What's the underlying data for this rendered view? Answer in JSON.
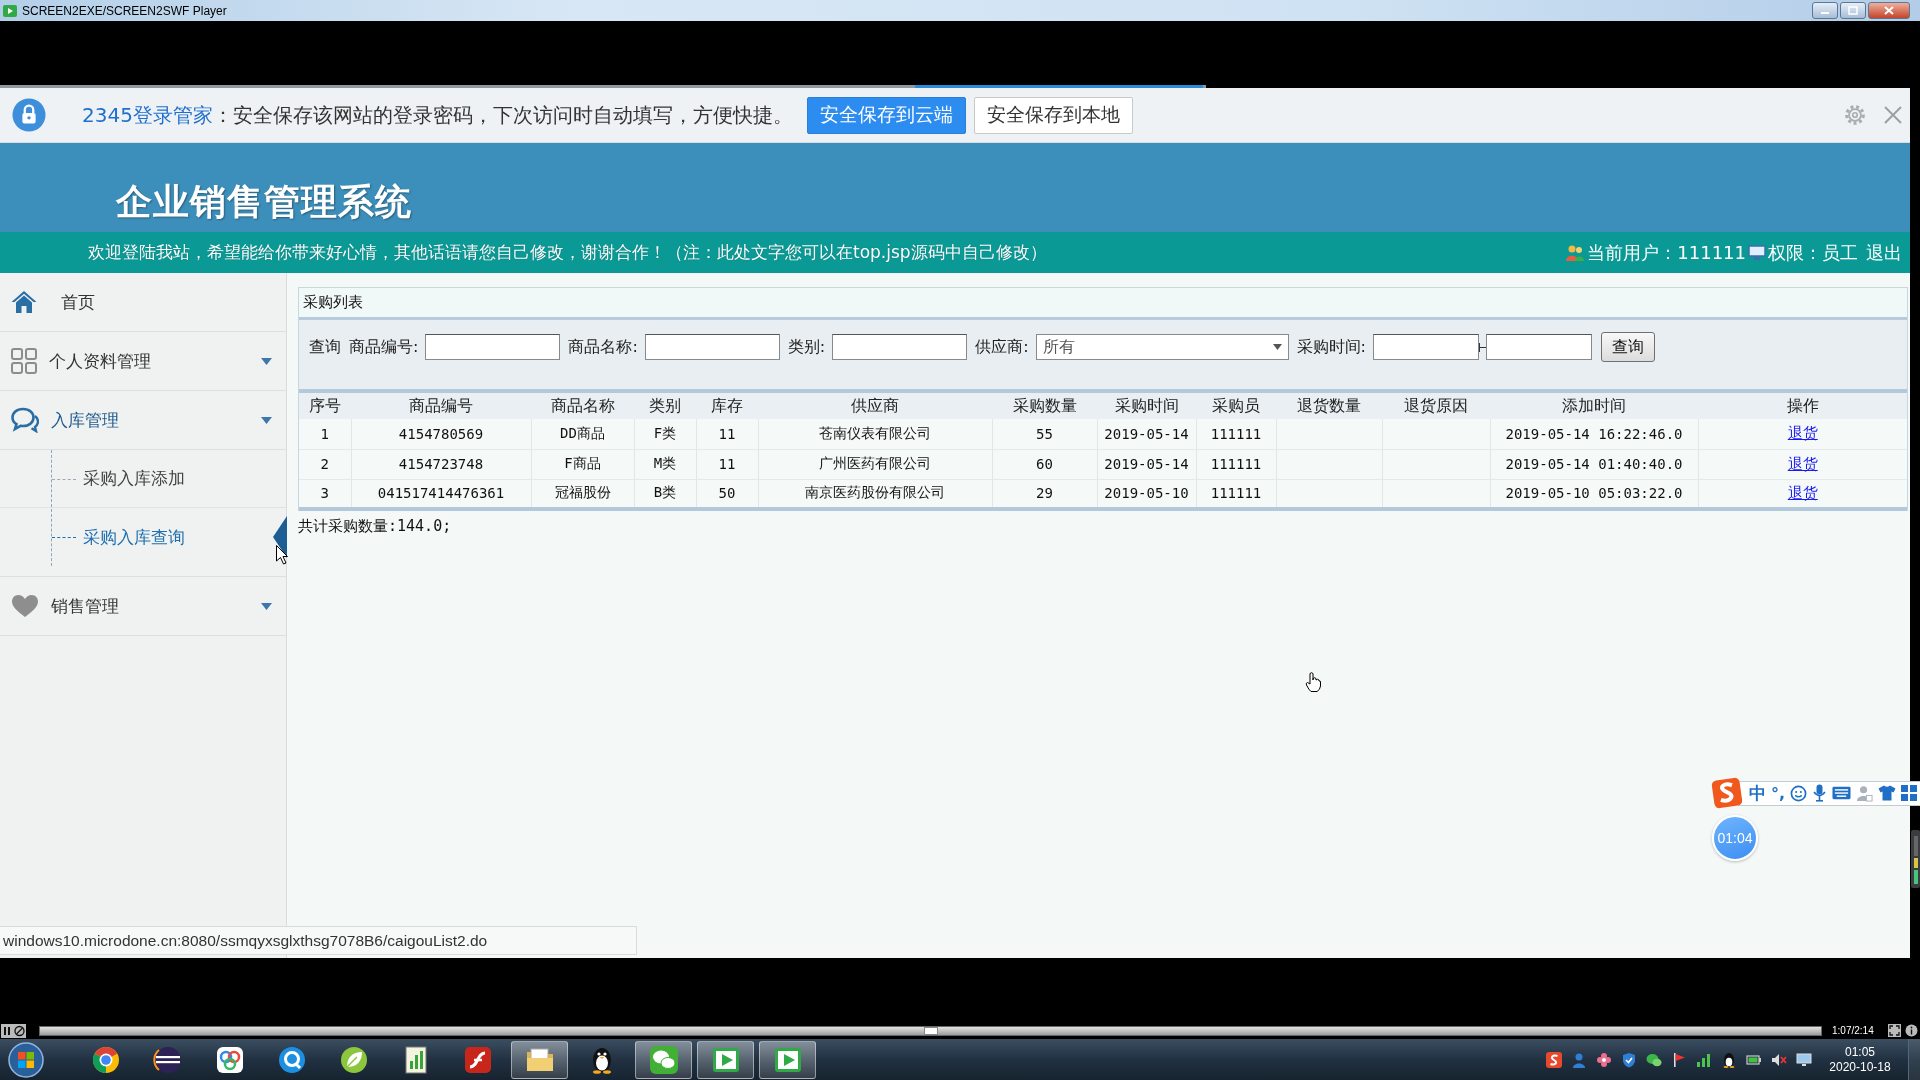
{
  "player_window": {
    "title": "SCREEN2EXE/SCREEN2SWF Player"
  },
  "password_bar": {
    "brand": "2345登录管家",
    "message": "：安全保存该网站的登录密码，下次访问时自动填写，方便快捷。",
    "buttons": [
      {
        "label": "安全保存到云端",
        "kind": "primary"
      },
      {
        "label": "安全保存到本地",
        "kind": "secondary"
      }
    ]
  },
  "header": {
    "title": "企业销售管理系统",
    "welcome": "欢迎登陆我站，希望能给你带来好心情，其他话语请您自己修改，谢谢合作！（注：此处文字您可以在top.jsp源码中自己修改）",
    "user": "当前用户：111111",
    "role": "权限：员工",
    "logout": "退出"
  },
  "sidebar": {
    "items": [
      {
        "kind": "link",
        "label": "首页"
      },
      {
        "kind": "group",
        "label": "个人资料管理",
        "expanded": false
      },
      {
        "kind": "group",
        "label": "入库管理",
        "expanded": true,
        "children": [
          {
            "label": "采购入库添加",
            "selected": false
          },
          {
            "label": "采购入库查询",
            "selected": true
          }
        ]
      },
      {
        "kind": "group",
        "label": "销售管理",
        "expanded": false
      }
    ]
  },
  "panel": {
    "title": "采购列表",
    "search": {
      "label": "查询",
      "fields": [
        {
          "kind": "input",
          "label": "商品编号:"
        },
        {
          "kind": "input",
          "label": "商品名称:"
        },
        {
          "kind": "input",
          "label": "类别:"
        },
        {
          "kind": "select",
          "label": "供应商:",
          "value": "所有"
        },
        {
          "kind": "range",
          "label": "采购时间:"
        }
      ],
      "button": "查询"
    },
    "table": {
      "columns": [
        "序号",
        "商品编号",
        "商品名称",
        "类别",
        "库存",
        "供应商",
        "采购数量",
        "采购时间",
        "采购员",
        "退货数量",
        "退货原因",
        "添加时间",
        "操作"
      ],
      "rows": [
        {
          "no": "1",
          "product_code": "4154780569",
          "product_name": "DD商品",
          "category": "F类",
          "stock": "11",
          "supplier": "苍南仪表有限公司",
          "quantity": "55",
          "purchase_date": "2019-05-14",
          "buyer": "111111",
          "added_time": "2019-05-14 16:22:46.0",
          "action": "退货"
        },
        {
          "no": "2",
          "product_code": "4154723748",
          "product_name": "F商品",
          "category": "M类",
          "stock": "11",
          "supplier": "广州医药有限公司",
          "quantity": "60",
          "purchase_date": "2019-05-14",
          "buyer": "111111",
          "added_time": "2019-05-14 01:40:40.0",
          "action": "退货"
        },
        {
          "no": "3",
          "product_code": "041517414476361",
          "product_name": "冠福股份",
          "category": "B类",
          "stock": "50",
          "supplier": "南京医药股份有限公司",
          "quantity": "29",
          "purchase_date": "2019-05-10",
          "buyer": "111111",
          "added_time": "2019-05-10 05:03:22.0",
          "action": "退货"
        }
      ]
    },
    "total": "共计采购数量:144.0;"
  },
  "status_url": "windows10.microdone.cn:8080/ssmqyxsglxthsg7078B6/caigouList2.do",
  "ime_toolbar": {
    "mode": "中",
    "punctuation": "°,"
  },
  "timer": "01:04",
  "player": {
    "level": 0.5,
    "time": "1:07/2:14"
  },
  "taskbar": {
    "apps": [
      {
        "active": false
      },
      {
        "active": false
      },
      {
        "active": false
      },
      {
        "active": false
      },
      {
        "active": false
      },
      {
        "active": false
      },
      {
        "active": false
      },
      {
        "active": true
      },
      {
        "active": false
      },
      {
        "active": true
      },
      {
        "active": true
      },
      {
        "active": true
      }
    ],
    "clock": {
      "time": "01:05",
      "date": "2020-10-18"
    }
  }
}
